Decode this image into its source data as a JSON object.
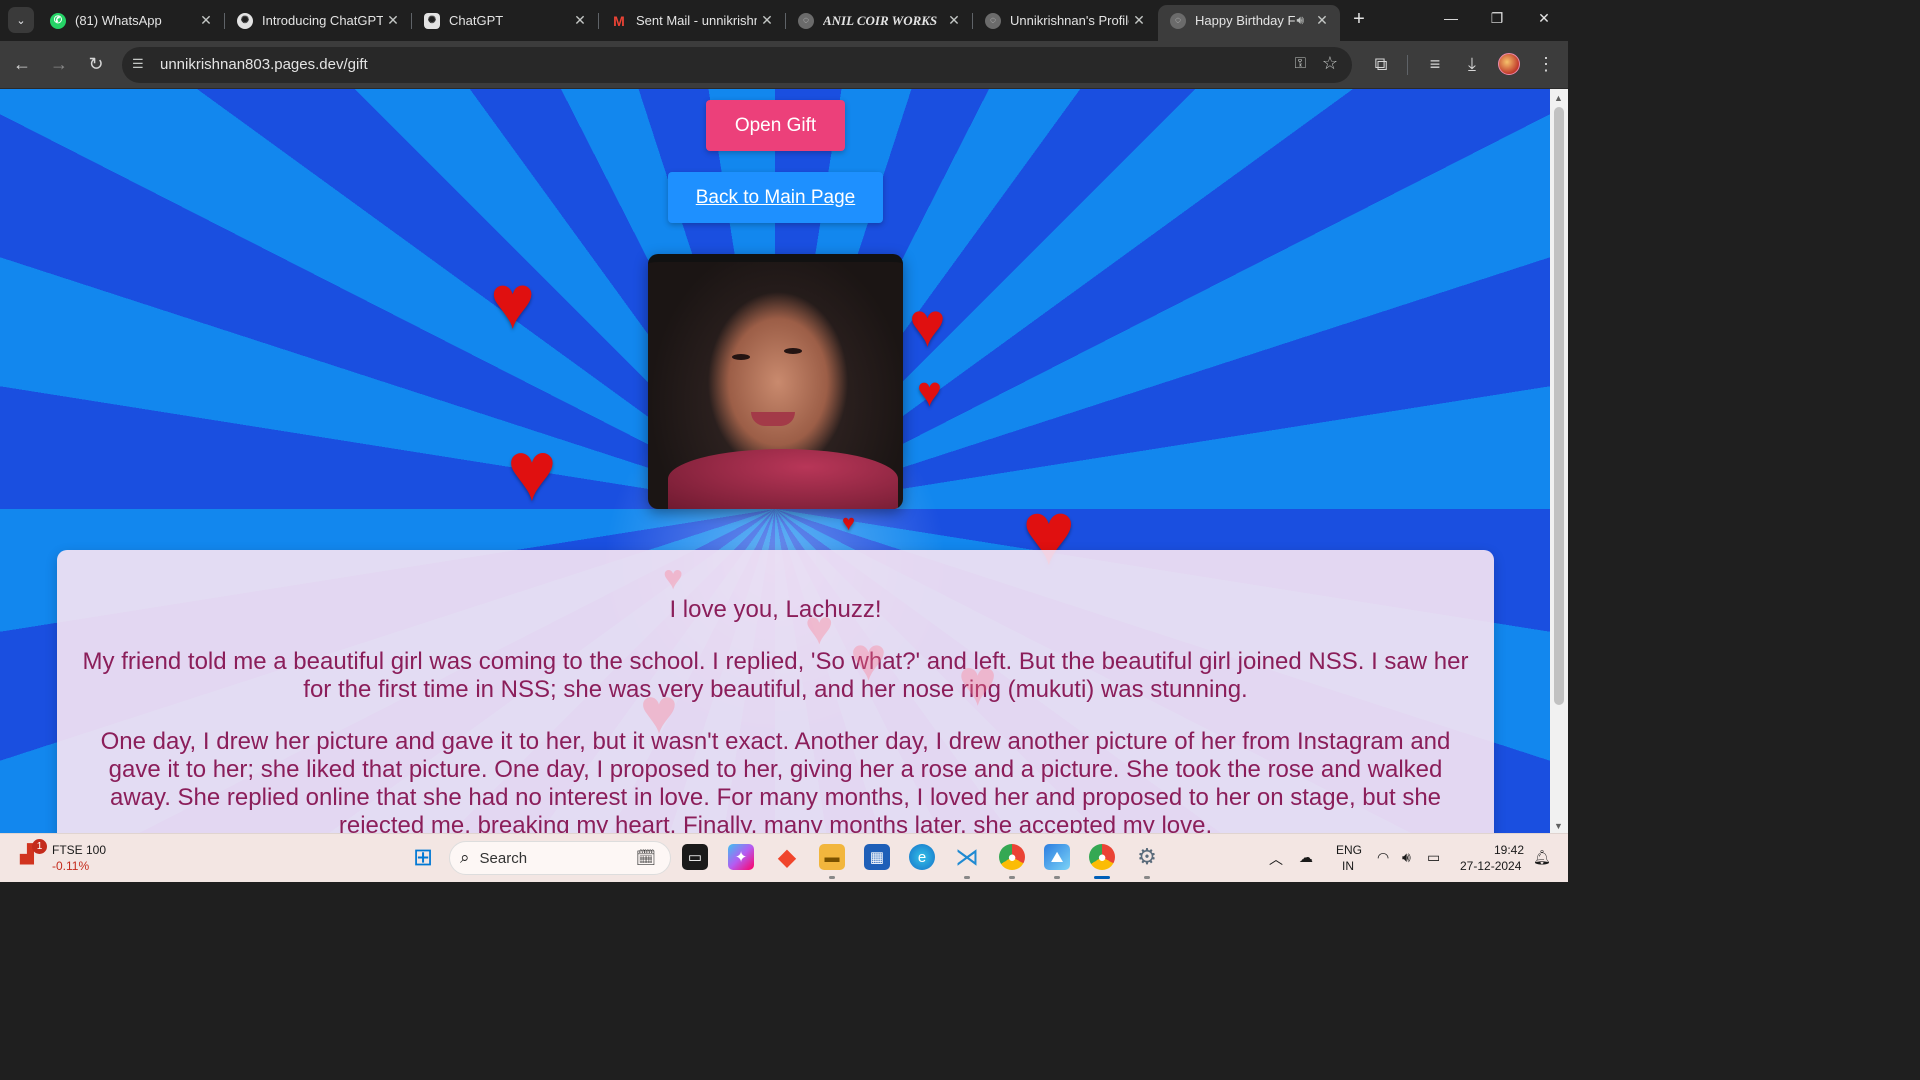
{
  "browser": {
    "tabs": [
      {
        "title": "(81) WhatsApp",
        "icon": "whatsapp-icon",
        "active": false
      },
      {
        "title": "Introducing ChatGPT",
        "icon": "chatgpt-icon",
        "active": false
      },
      {
        "title": "ChatGPT",
        "icon": "chatgpt-icon",
        "active": false
      },
      {
        "title": "Sent Mail - unnikrishn",
        "icon": "gmail-icon",
        "active": false
      },
      {
        "title": "ANIL COIR WORKS",
        "icon": "globe-icon",
        "active": false
      },
      {
        "title": "Unnikrishnan's Profile",
        "icon": "globe-icon",
        "active": false
      },
      {
        "title": "Happy Birthday F",
        "icon": "globe-icon",
        "active": true
      }
    ],
    "url": "unnikrishnan803.pages.dev/gift"
  },
  "page": {
    "open_gift_label": "Open Gift",
    "back_label": "Back to Main Page",
    "heading": "I love you, Lachuzz!",
    "paragraphs": [
      "My friend told me a beautiful girl was coming to the school. I replied, 'So what?' and left. But the beautiful girl joined NSS. I saw her for the first time in NSS; she was very beautiful, and her nose ring (mukuti) was stunning.",
      "One day, I drew her picture and gave it to her, but it wasn't exact. Another day, I drew another picture of her from Instagram and gave it to her; she liked that picture. One day, I proposed to her, giving her a rose and a picture. She took the rose and walked away. She replied online that she had no interest in love. For many months, I loved her and proposed to her on stage, but she rejected me, breaking my heart. Finally, many months later, she accepted my love."
    ],
    "colors": {
      "open_button": "#ec407a",
      "back_button": "#1e90ff",
      "message_text": "#8b1e5a",
      "heart": "#e01010"
    }
  },
  "taskbar": {
    "stock_name": "FTSE 100",
    "stock_change": "-0.11%",
    "stock_badge": "1",
    "search_placeholder": "Search",
    "language": "ENG",
    "region": "IN",
    "time": "19:42",
    "date": "27-12-2024",
    "apps": [
      "windows-start-icon",
      "task-view-icon",
      "copilot-icon",
      "office-icon",
      "file-explorer-icon",
      "microsoft-store-icon",
      "edge-icon",
      "vscode-icon",
      "chrome-icon",
      "photos-icon",
      "chrome-active-icon",
      "settings-icon"
    ]
  }
}
